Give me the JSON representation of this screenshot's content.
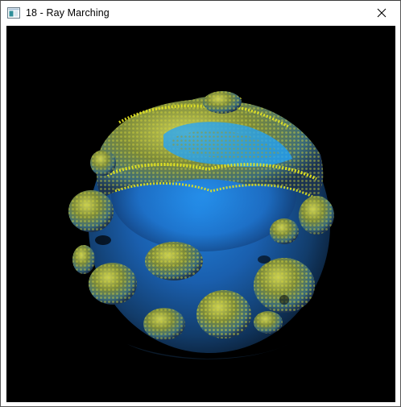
{
  "window": {
    "title": "18 - Ray Marching",
    "app_icon": "window-app-icon",
    "close_icon": "close-icon"
  },
  "scene": {
    "description_icon": "mandelbulb-render",
    "background_color": "#000000",
    "colors": {
      "glow_yellow": "#e8e61a",
      "olive": "#8a8a2a",
      "teal": "#3f8f9a",
      "blue": "#1e6fc8",
      "deep_blue": "#0f3f7a",
      "shadow": "#0a1a2a"
    }
  }
}
